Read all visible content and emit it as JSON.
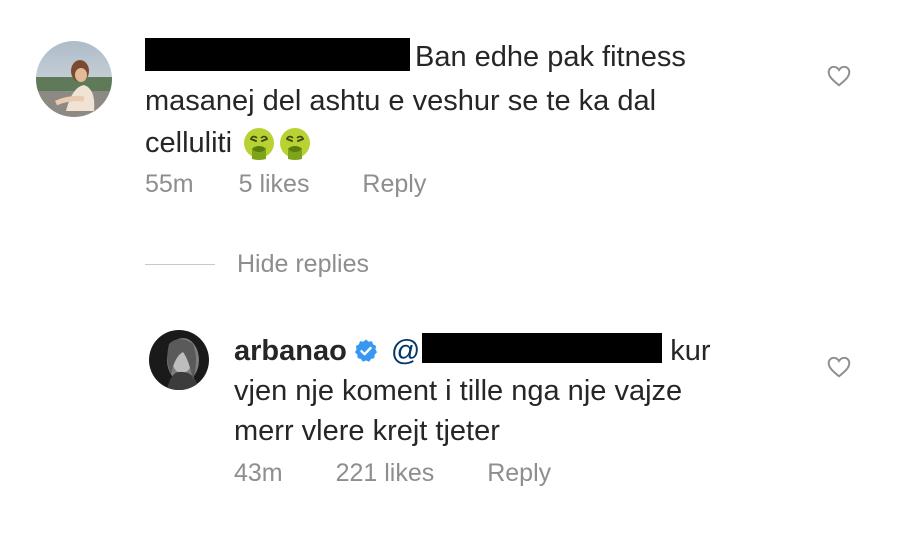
{
  "comments": [
    {
      "line1": "Ban edhe pak fitness",
      "line2": "masanej del ashtu e veshur se te ka dal",
      "line3": "celluliti",
      "emoji": [
        "nauseated-vomit-face-icon",
        "nauseated-vomit-face-icon"
      ],
      "time": "55m",
      "likes": "5 likes",
      "reply": "Reply"
    }
  ],
  "hide_replies": "Hide replies",
  "reply": {
    "username": "arbanao",
    "verified": true,
    "mention_prefix": "@",
    "text_after_mention": "kur",
    "line2": "vjen nje koment i tille nga nje vajze",
    "line3": "merr vlere krejt tjeter",
    "time": "43m",
    "likes": "221 likes",
    "reply_label": "Reply"
  },
  "colors": {
    "text": "#262626",
    "meta": "#8e8e8e",
    "verified_blue": "#3897f0",
    "mention": "#00376b",
    "redaction": "#000000"
  },
  "icons": {
    "like": "heart-outline-icon",
    "verified": "verified-badge-icon"
  }
}
